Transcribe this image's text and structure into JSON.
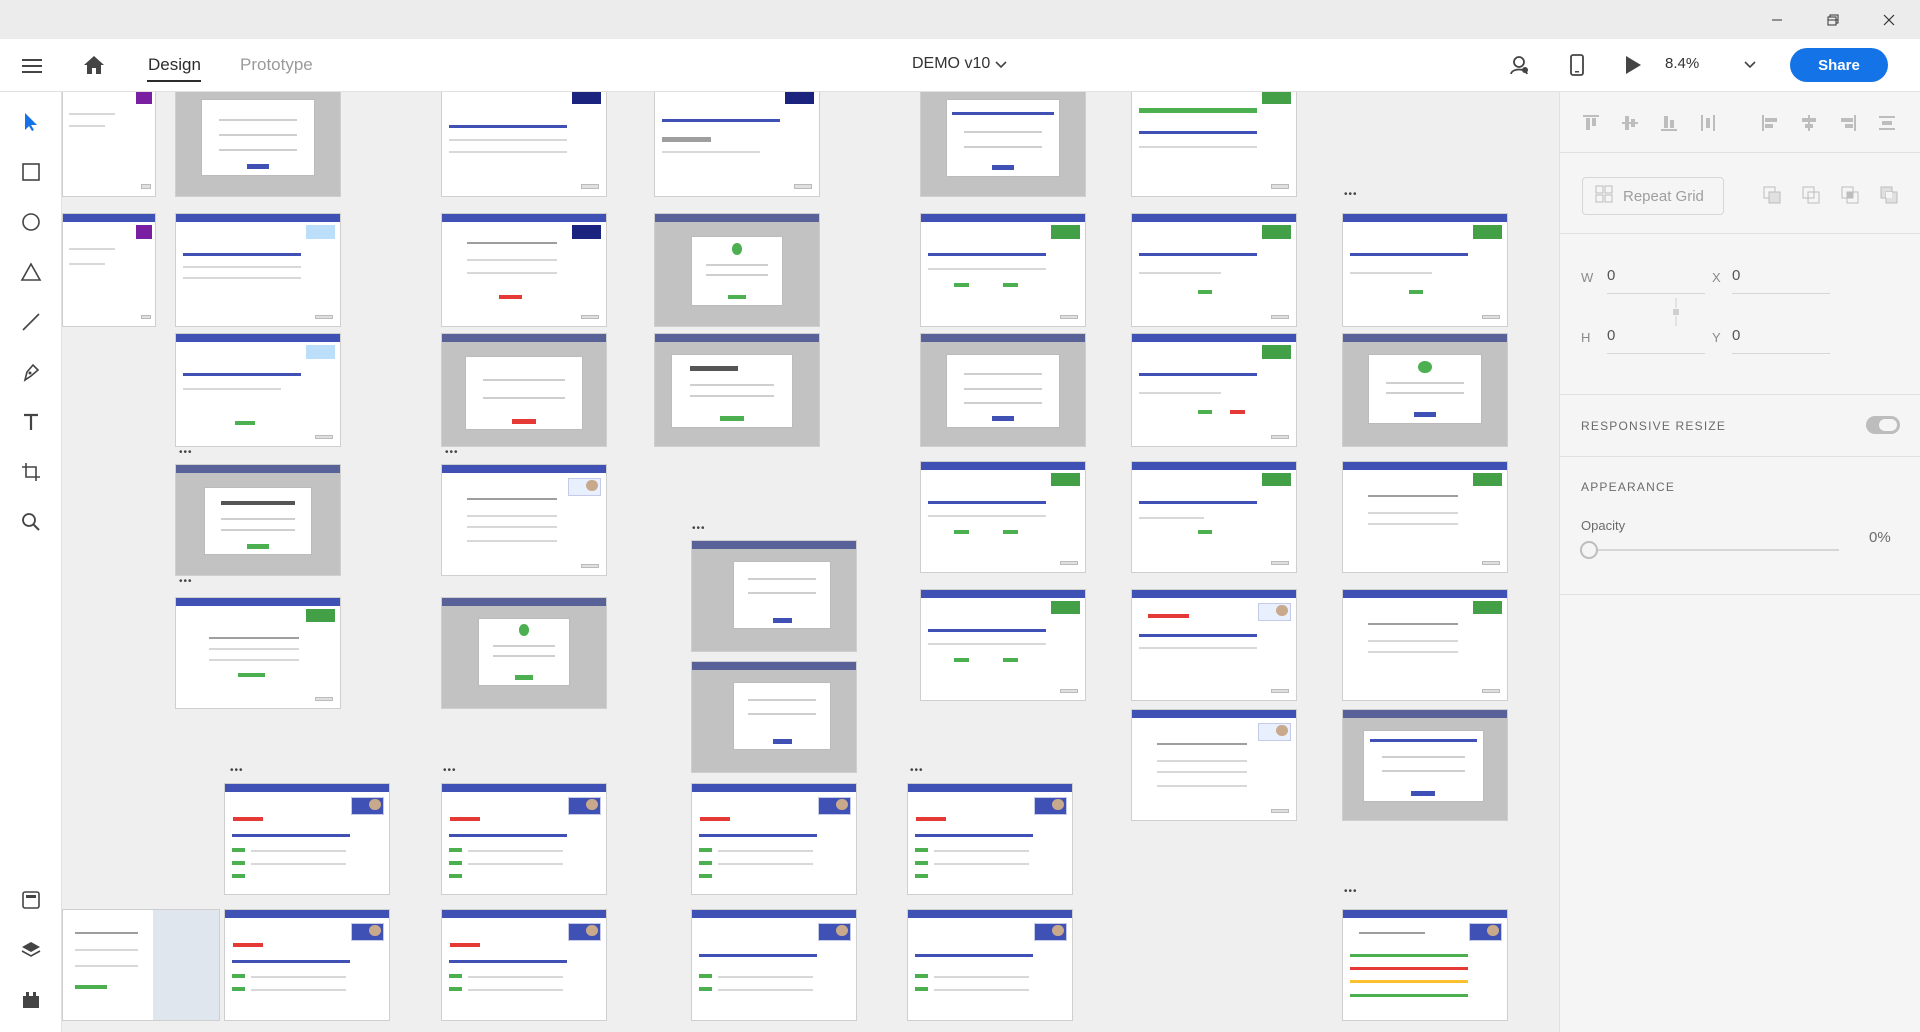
{
  "window": {
    "controls": [
      "minimize-icon",
      "restore-icon",
      "close-icon"
    ]
  },
  "topbar": {
    "menu_icon": "hamburger-menu-icon",
    "home_icon": "home-icon",
    "tabs": [
      {
        "label": "Design",
        "active": true
      },
      {
        "label": "Prototype",
        "active": false
      }
    ],
    "document_title": "DEMO v10",
    "title_dropdown_icon": "chevron-down-icon",
    "user_icon": "user-icon",
    "device_preview_icon": "mobile-device-icon",
    "play_icon": "play-icon",
    "zoom": "8.4%",
    "zoom_dropdown_icon": "chevron-down-icon",
    "share_label": "Share",
    "accent_color": "#1473e6"
  },
  "toolbar": {
    "tools": [
      "select-icon",
      "rectangle-icon",
      "ellipse-icon",
      "triangle-icon",
      "line-icon",
      "pen-icon",
      "text-icon",
      "artboard-icon",
      "zoom-icon"
    ],
    "bottom_tools": [
      "assets-icon",
      "layers-icon",
      "plugins-icon"
    ]
  },
  "canvas": {
    "background": "#efefef",
    "artboard_header_color": "#3f51b5"
  },
  "panel": {
    "align_icons": [
      "align-top-icon",
      "align-middle-icon",
      "align-bottom-icon",
      "distribute-vertical-icon",
      "align-left-icon",
      "align-center-icon",
      "align-right-icon",
      "distribute-horizontal-icon"
    ],
    "repeat_grid_label": "Repeat Grid",
    "boolean_icons": [
      "add-icon",
      "subtract-icon",
      "intersect-icon",
      "exclude-icon"
    ],
    "w_label": "W",
    "w_value": "0",
    "x_label": "X",
    "x_value": "0",
    "h_label": "H",
    "h_value": "0",
    "y_label": "Y",
    "y_value": "0",
    "responsive_resize_label": "RESPONSIVE RESIZE",
    "responsive_resize_on": false,
    "appearance_label": "APPEARANCE",
    "opacity_label": "Opacity",
    "opacity_value": "0%"
  }
}
